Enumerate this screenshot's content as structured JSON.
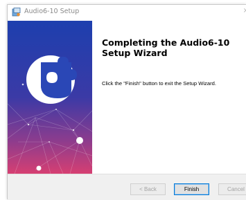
{
  "window": {
    "title": "Audio6-10 Setup",
    "close_glyph": "×",
    "app_icon": "installer-icon"
  },
  "banner": {
    "logo_icon": "puzzle-logo-icon",
    "colors": {
      "top": "#1d3fae",
      "mid": "#5a3a9e",
      "bottom": "#d63f72"
    }
  },
  "content": {
    "heading": "Completing the Audio6-10 Setup Wizard",
    "message": "Click the \"Finish\" button to exit the Setup Wizard."
  },
  "buttons": {
    "back": "< Back",
    "finish": "Finish",
    "cancel": "Cancel"
  },
  "colors": {
    "accent": "#0078d7",
    "footer_bg": "#f0f0f0"
  }
}
